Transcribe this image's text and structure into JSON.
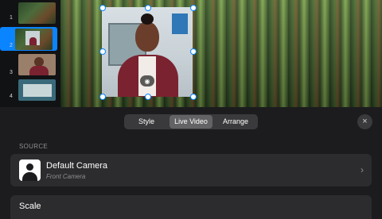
{
  "slides": [
    {
      "number": "1",
      "selected": false
    },
    {
      "number": "2",
      "selected": true
    },
    {
      "number": "3",
      "selected": false
    },
    {
      "number": "4",
      "selected": false
    }
  ],
  "tabs": [
    {
      "label": "Style",
      "active": false
    },
    {
      "label": "Live Video",
      "active": true
    },
    {
      "label": "Arrange",
      "active": false
    }
  ],
  "close_icon": "×",
  "source": {
    "section_label": "SOURCE",
    "camera_title": "Default Camera",
    "camera_subtitle": "Front Camera",
    "chevron": "›"
  },
  "scale": {
    "label": "Scale"
  },
  "colors": {
    "accent": "#0a84ff",
    "panel_bg": "#1c1c1e",
    "row_bg": "#2c2c2e"
  }
}
